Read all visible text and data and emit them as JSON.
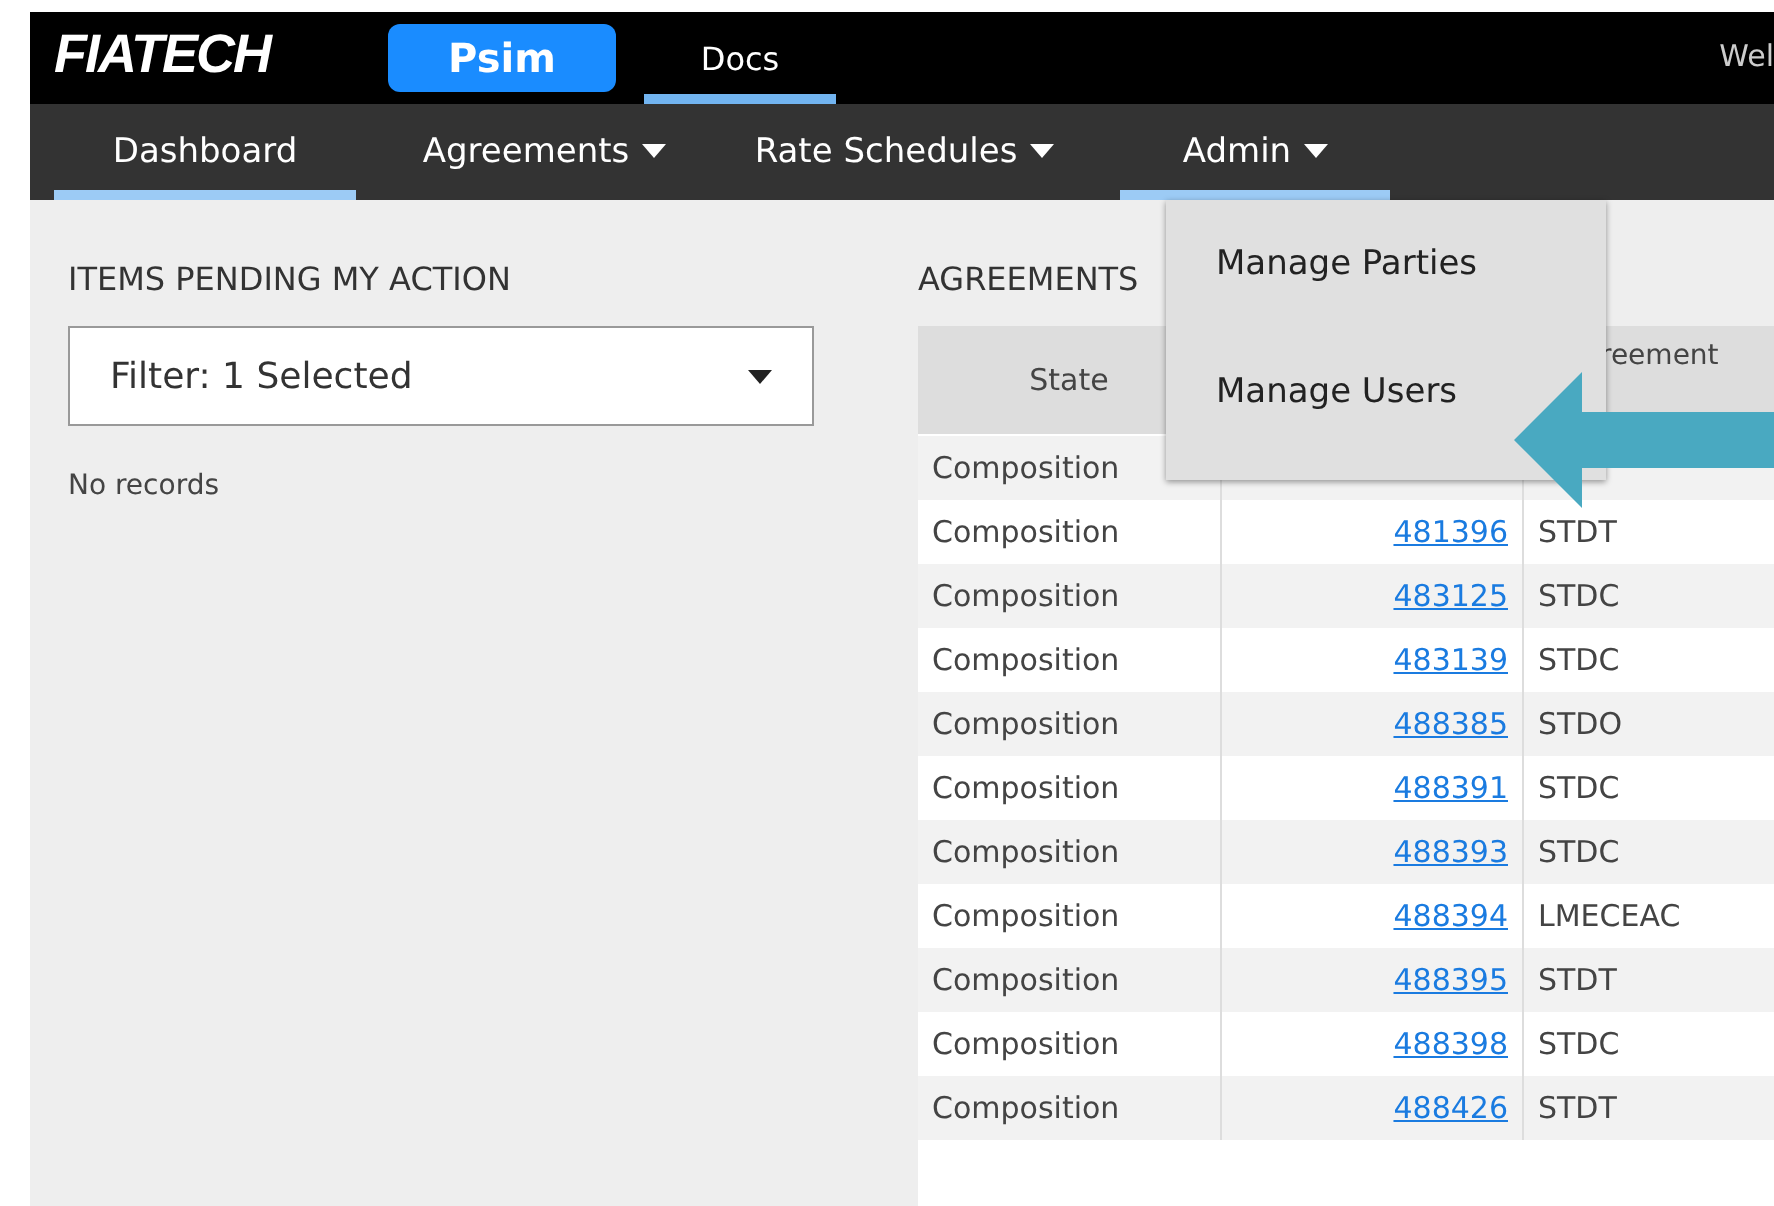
{
  "header": {
    "logo": "FIATECH",
    "app_button": "Psim",
    "tabs": [
      {
        "label": "Docs",
        "selected": true
      }
    ],
    "welcome": "Wel"
  },
  "nav": [
    {
      "label": "Dashboard",
      "selected": true,
      "dropdown": false
    },
    {
      "label": "Agreements",
      "selected": false,
      "dropdown": true
    },
    {
      "label": "Rate Schedules",
      "selected": false,
      "dropdown": true
    },
    {
      "label": "Admin",
      "selected": true,
      "dropdown": true
    }
  ],
  "admin_menu": [
    "Manage Parties",
    "Manage Users"
  ],
  "pending": {
    "title": "ITEMS PENDING MY ACTION",
    "filter": "Filter: 1 Selected",
    "empty": "No records"
  },
  "agreements": {
    "title": "AGREEMENTS",
    "columns": [
      {
        "label": "State"
      },
      {},
      {
        "label": "reement"
      }
    ],
    "rows": [
      {
        "state": "Composition"
      },
      {
        "state": "Composition",
        "number": "481396",
        "type": "STDT"
      },
      {
        "state": "Composition",
        "number": "483125",
        "type": "STDC"
      },
      {
        "state": "Composition",
        "number": "483139",
        "type": "STDC"
      },
      {
        "state": "Composition",
        "number": "488385",
        "type": "STDO"
      },
      {
        "state": "Composition",
        "number": "488391",
        "type": "STDC"
      },
      {
        "state": "Composition",
        "number": "488393",
        "type": "STDC"
      },
      {
        "state": "Composition",
        "number": "488394",
        "type": "LMECEAC"
      },
      {
        "state": "Composition",
        "number": "488395",
        "type": "STDT"
      },
      {
        "state": "Composition",
        "number": "488398",
        "type": "STDC"
      },
      {
        "state": "Composition",
        "number": "488426",
        "type": "STDT"
      }
    ]
  }
}
